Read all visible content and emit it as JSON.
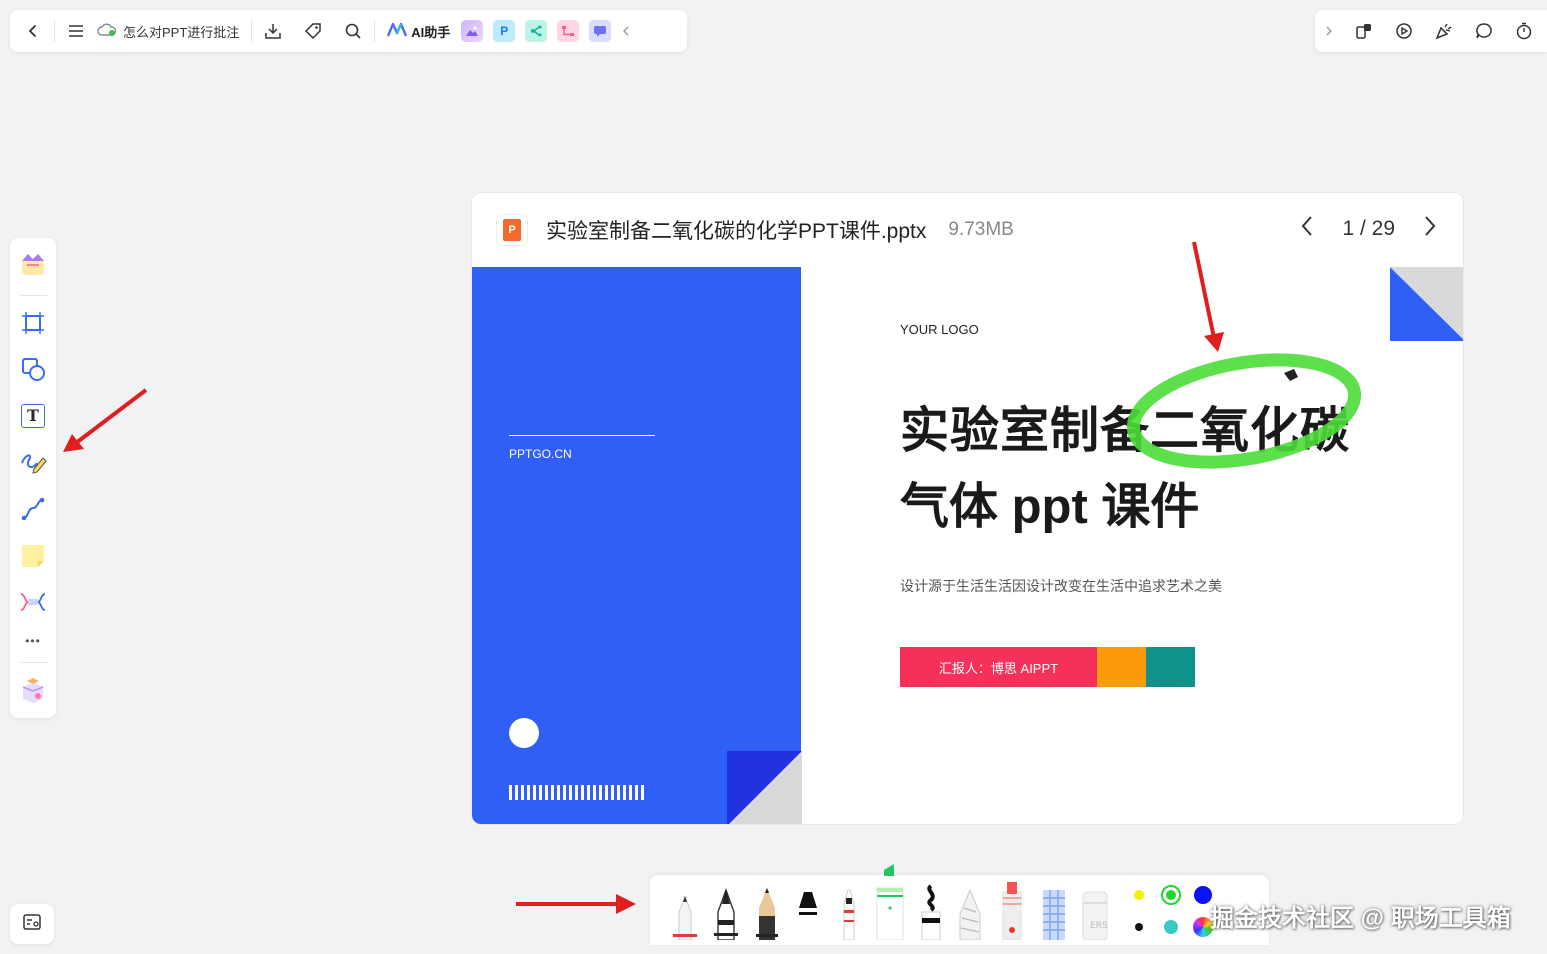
{
  "topbar": {
    "doc_title": "怎么对PPT进行批注",
    "ai_label": "AI助手",
    "icons": [
      "back-icon",
      "menu-icon",
      "cloud-sync-icon",
      "download-icon",
      "tag-icon",
      "search-icon",
      "ai-logo-icon",
      "image-app-icon",
      "p-app-icon",
      "mindmap-app-icon",
      "flow-app-icon",
      "chat-app-icon",
      "collapse-left-icon"
    ]
  },
  "topright": {
    "icons": [
      "expand-right-icon",
      "share-icon",
      "present-icon",
      "celebrate-icon",
      "comment-icon",
      "timer-icon"
    ]
  },
  "left_tools": {
    "icons": [
      "template-icon",
      "frame-icon",
      "shape-icon",
      "text-icon",
      "pen-icon",
      "connector-icon",
      "sticky-note-icon",
      "mindmap-icon",
      "more-icon",
      "widget-box-icon"
    ],
    "text_tool_glyph": "T",
    "more_glyph": "•••"
  },
  "card": {
    "file_name": "实验室制备二氧化碳的化学PPT课件.pptx",
    "file_size": "9.73MB",
    "file_badge": "P",
    "page_indicator": "1 / 29"
  },
  "slide": {
    "site": "PPTGO.CN",
    "logo_text": "YOUR LOGO",
    "title_line1": "实验室制备二氧化碳",
    "title_line2": "气体 ppt 课件",
    "subtitle": "设计源于生活生活因设计改变在生活中追求艺术之美",
    "reporter": "汇报人：博思 AIPPT",
    "colors": {
      "blue": "#2f5ff5",
      "red": "#f5315a",
      "orange": "#fb9a0d",
      "teal": "#10918a",
      "highlight": "#4cdd3a"
    }
  },
  "pen_toolbar": {
    "tools": [
      "ballpoint-pen",
      "fountain-pen",
      "pencil",
      "marker",
      "fineliner",
      "highlighter",
      "brush-pen",
      "crayon",
      "red-marker",
      "pattern-pen",
      "eraser"
    ],
    "colors": [
      "#f1f100",
      "#1fd82a",
      "#0a14f0",
      "#111111",
      "#3cc9c6",
      "rainbow"
    ],
    "selected_tool": "highlighter",
    "selected_color": "#1fd82a"
  },
  "watermark": "掘金技术社区 @ 职场工具箱"
}
